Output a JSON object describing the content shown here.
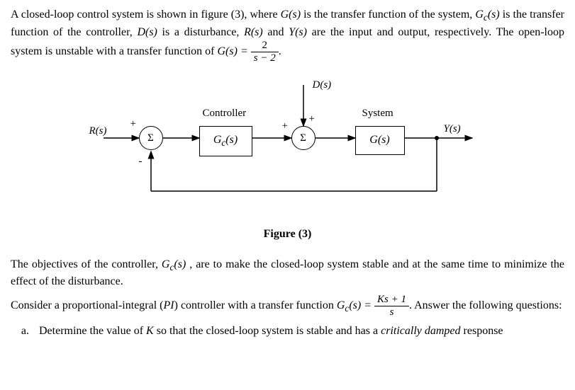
{
  "intro": {
    "line1a": "A closed-loop control system is shown in figure (3), where ",
    "Gs": "G(s)",
    "line1b": " is the transfer function of the system, ",
    "Gcs": "G",
    "Gcs_sub": "c",
    "Gcs_arg": "(s)",
    "line1c": " is the transfer function of the controller, ",
    "Ds": "D(s)",
    "line1d": " is a disturbance, ",
    "Rs": "R(s)",
    "and": " and ",
    "Ys": "Y(s)",
    "line1e": " are the input and output, respectively. The open-loop system is unstable with a transfer function of ",
    "Gs_eq": "G(s) = ",
    "frac_num1": "2",
    "frac_den1": "s − 2",
    "period": "."
  },
  "diagram": {
    "Rs": "R(s)",
    "Ds": "D(s)",
    "Ys": "Y(s)",
    "sigma": "Σ",
    "plus": "+",
    "minus": "-",
    "controller_label": "Controller",
    "system_label": "System",
    "Gc_block": "G",
    "Gc_sub": "c",
    "Gc_arg": "(s)",
    "G_block": "G(s)"
  },
  "caption": "Figure (3)",
  "objectives": {
    "line_a": "The objectives of the controller, ",
    "Gcs2": "G",
    "Gcs2_sub": "c",
    "Gcs2_arg": "(s)",
    "line_b": " , are to make the closed-loop system stable and at the same time to minimize the effect of the disturbance."
  },
  "pi": {
    "line_a": "Consider a proportional-integral (",
    "PI": "PI",
    "line_b": ") controller with a transfer function ",
    "Gcs3": "G",
    "Gcs3_sub": "c",
    "Gcs3_arg": "(s) = ",
    "frac_num": "Ks + 1",
    "frac_den": "s",
    "line_c": ". Answer the following questions:"
  },
  "question_a": {
    "text_a": "Determine the value of ",
    "K": "K",
    "text_b": " so that the closed-loop system is stable and has a ",
    "crit": "critically damped",
    "text_c": " response"
  },
  "chart_data": {
    "type": "block-diagram",
    "nodes": [
      {
        "id": "R",
        "label": "R(s)",
        "kind": "input"
      },
      {
        "id": "sum1",
        "label": "Σ",
        "kind": "summing",
        "signs": [
          "+",
          "-"
        ]
      },
      {
        "id": "Gc",
        "label": "G_c(s)",
        "kind": "block",
        "title": "Controller"
      },
      {
        "id": "sum2",
        "label": "Σ",
        "kind": "summing",
        "signs": [
          "+",
          "+"
        ]
      },
      {
        "id": "D",
        "label": "D(s)",
        "kind": "input"
      },
      {
        "id": "G",
        "label": "G(s)",
        "kind": "block",
        "title": "System"
      },
      {
        "id": "Y",
        "label": "Y(s)",
        "kind": "output"
      }
    ],
    "edges": [
      {
        "from": "R",
        "to": "sum1"
      },
      {
        "from": "sum1",
        "to": "Gc"
      },
      {
        "from": "Gc",
        "to": "sum2"
      },
      {
        "from": "D",
        "to": "sum2"
      },
      {
        "from": "sum2",
        "to": "G"
      },
      {
        "from": "G",
        "to": "Y"
      },
      {
        "from": "Y",
        "to": "sum1",
        "feedback": true,
        "sign": "-"
      }
    ],
    "equations": {
      "G(s)": "2 / (s - 2)",
      "G_c(s)": "(K s + 1) / s"
    }
  }
}
